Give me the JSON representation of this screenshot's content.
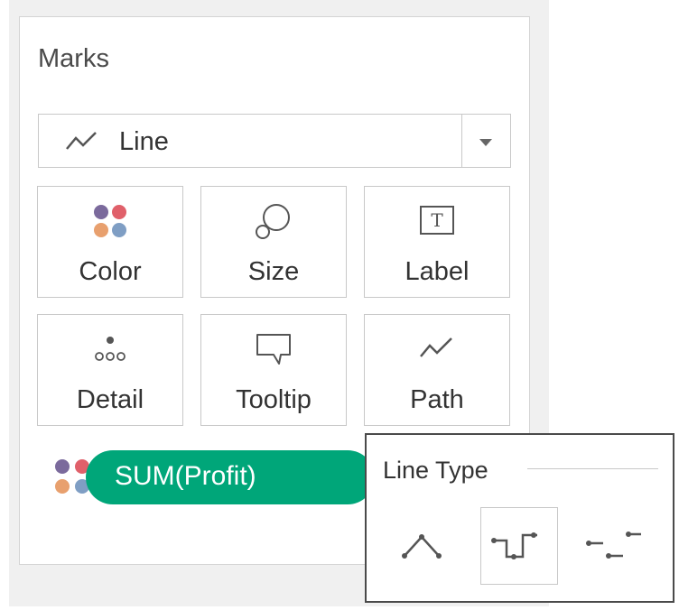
{
  "marks": {
    "title": "Marks",
    "mark_type": {
      "label": "Line",
      "icon": "line-icon"
    },
    "properties": [
      {
        "label": "Color",
        "icon": "color-dots-icon"
      },
      {
        "label": "Size",
        "icon": "size-icon"
      },
      {
        "label": "Label",
        "icon": "label-text-icon"
      },
      {
        "label": "Detail",
        "icon": "detail-icon"
      },
      {
        "label": "Tooltip",
        "icon": "tooltip-icon"
      },
      {
        "label": "Path",
        "icon": "path-icon"
      }
    ],
    "color_pill": {
      "label": "SUM(Profit)",
      "color": "#00a679"
    }
  },
  "line_type_popup": {
    "title": "Line Type",
    "options": [
      {
        "name": "linear",
        "icon": "linear-line-icon",
        "selected": false
      },
      {
        "name": "step",
        "icon": "step-line-icon",
        "selected": true
      },
      {
        "name": "jump",
        "icon": "jump-line-icon",
        "selected": false
      }
    ]
  },
  "colors": {
    "dot_purple": "#7b6a9c",
    "dot_red": "#e0606a",
    "dot_orange": "#e8a06e",
    "dot_blue": "#7f9ec4"
  }
}
